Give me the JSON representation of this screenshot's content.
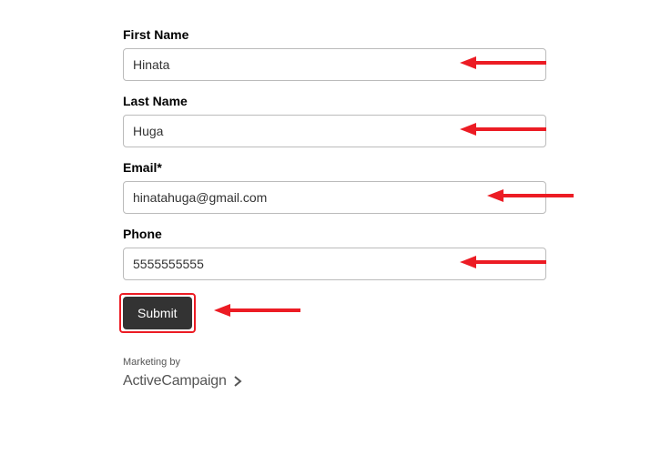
{
  "form": {
    "fields": [
      {
        "label": "First Name",
        "value": "Hinata",
        "name": "first-name"
      },
      {
        "label": "Last Name",
        "value": "Huga",
        "name": "last-name"
      },
      {
        "label": "Email*",
        "value": "hinatahuga@gmail.com",
        "name": "email"
      },
      {
        "label": "Phone",
        "value": "5555555555",
        "name": "phone"
      }
    ],
    "submit_label": "Submit"
  },
  "footer": {
    "marketing_by": "Marketing by",
    "brand_active": "Active",
    "brand_campaign": "Campaign"
  },
  "annotation": {
    "arrow_color": "#EC1C24"
  }
}
